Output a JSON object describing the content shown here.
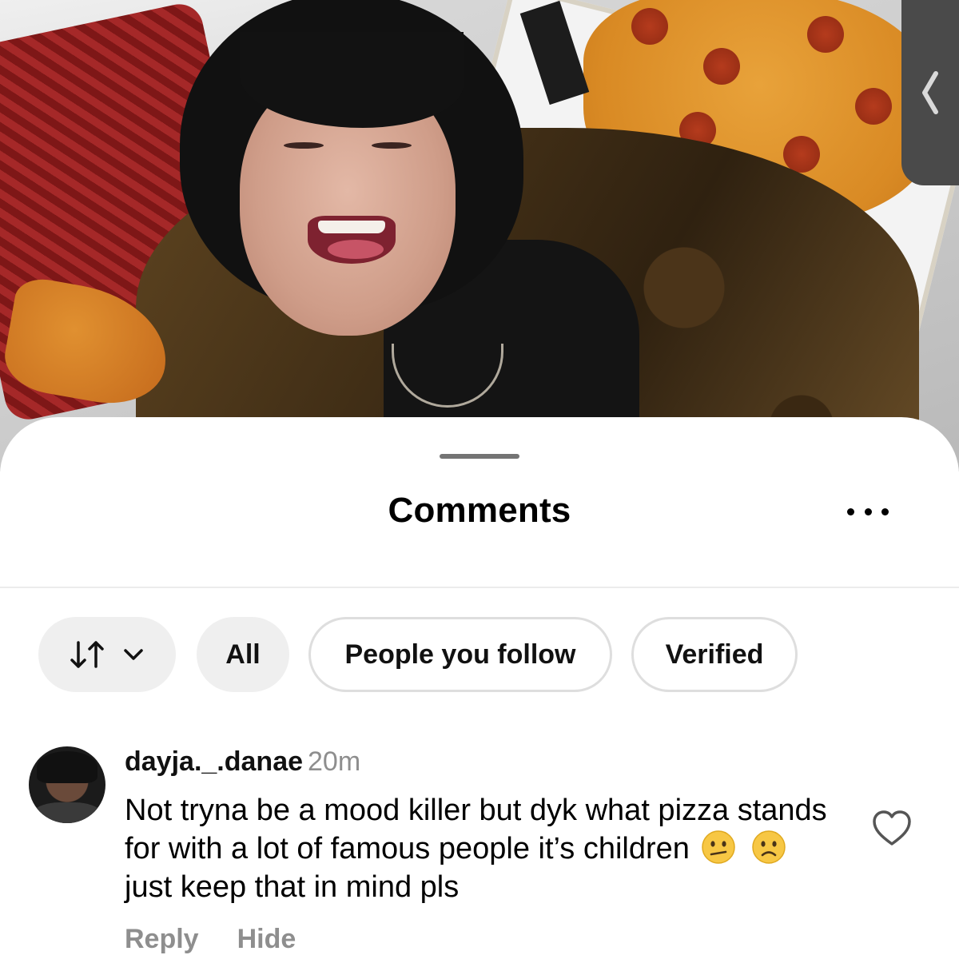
{
  "sheet": {
    "title": "Comments"
  },
  "filters": {
    "sort_icon": "sort-arrows-icon",
    "chips": [
      {
        "label": "All",
        "style": "filled"
      },
      {
        "label": "People you follow",
        "style": "outlined"
      },
      {
        "label": "Verified",
        "style": "outlined"
      }
    ]
  },
  "comment": {
    "username": "dayja._.danae",
    "time": "20m",
    "text_before": "Not tryna be a mood killer but dyk what pizza stands for with a lot of famous people it’s children",
    "emojis": [
      "confused-face-emoji",
      "slightly-frowning-face-emoji"
    ],
    "text_after": "just keep that in mind pls",
    "actions": {
      "reply": "Reply",
      "hide": "Hide"
    },
    "liked": false
  },
  "colors": {
    "sheet_bg": "#ffffff",
    "chip_filled": "#efefef",
    "chip_border": "#dedede",
    "meta_gray": "#8e8e8e"
  }
}
